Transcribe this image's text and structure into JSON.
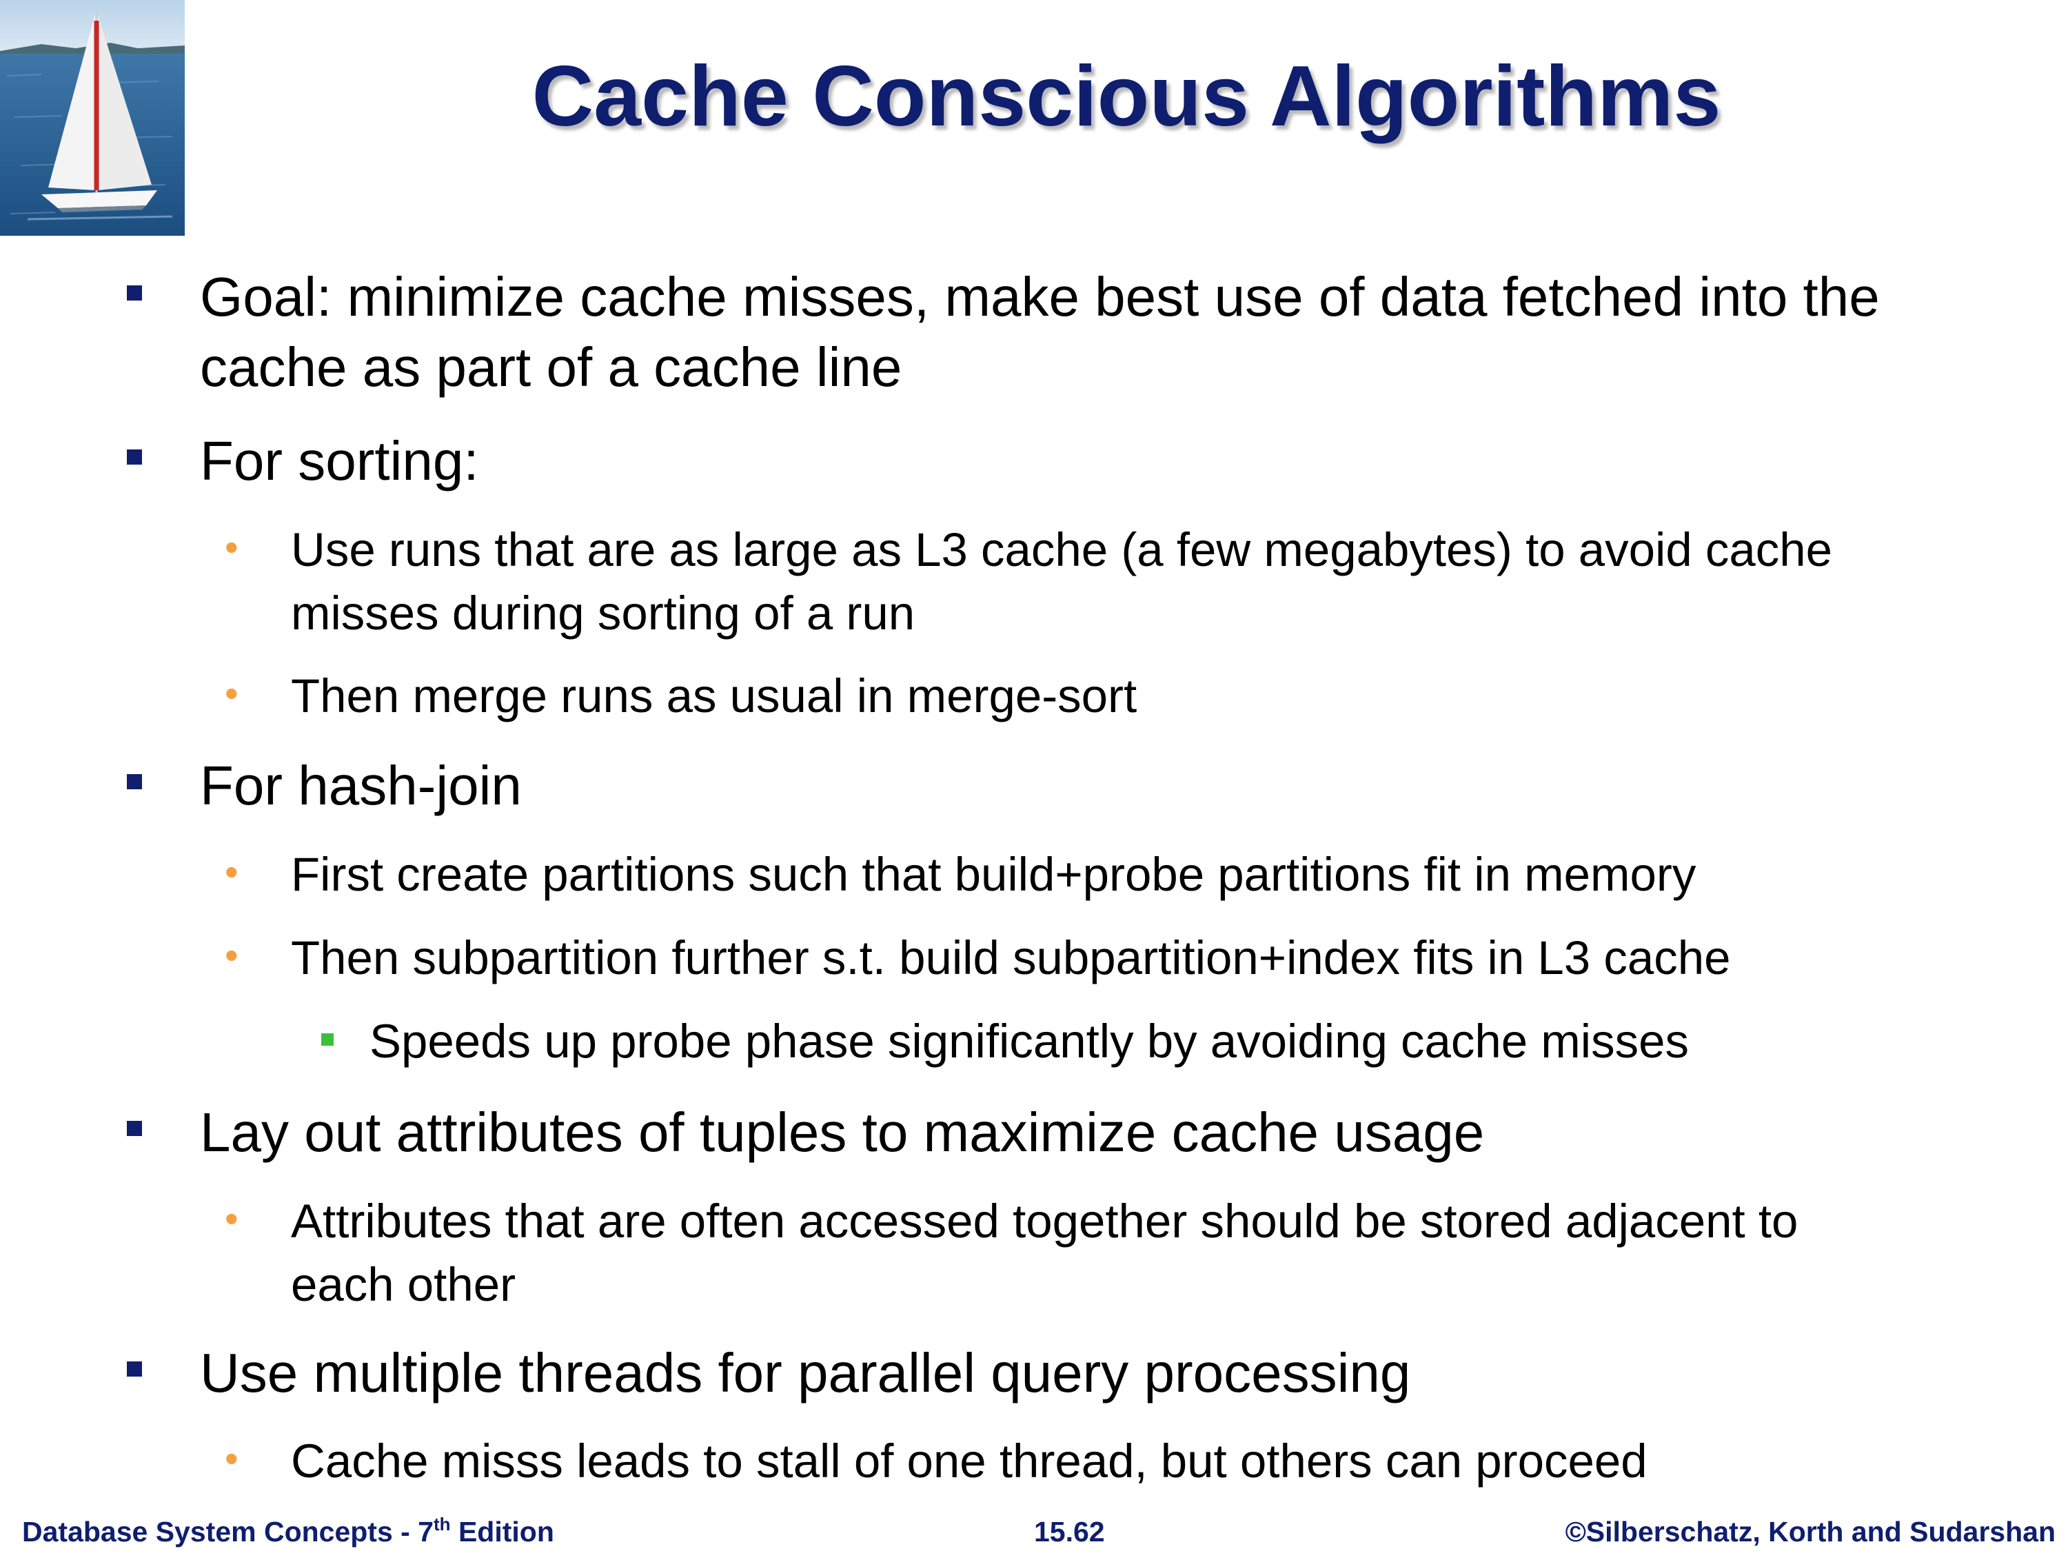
{
  "title": "Cache Conscious Algorithms",
  "bullets": [
    {
      "level": 1,
      "line1": "Goal: minimize cache misses, make best use of data fetched into the",
      "line2": "cache as part of a cache line"
    },
    {
      "level": 1,
      "line1": "For sorting:"
    },
    {
      "level": 2,
      "line1": "Use runs that are as large as L3 cache (a few megabytes) to avoid cache",
      "line2": "misses during sorting of a run"
    },
    {
      "level": 2,
      "line1": "Then merge runs as usual in merge-sort"
    },
    {
      "level": 1,
      "line1": "For hash-join"
    },
    {
      "level": 2,
      "line1": "First create partitions such that build+probe partitions fit in memory"
    },
    {
      "level": 2,
      "line1": "Then subpartition further s.t. build subpartition+index fits in L3 cache"
    },
    {
      "level": 3,
      "line1": "Speeds up probe phase significantly by avoiding cache misses"
    },
    {
      "level": 1,
      "line1": "Lay out attributes of tuples to maximize cache usage"
    },
    {
      "level": 2,
      "line1": "Attributes that are often accessed together should be stored adjacent to",
      "line2": "each other"
    },
    {
      "level": 1,
      "line1": "Use multiple threads for parallel query processing"
    },
    {
      "level": 2,
      "line1": "Cache misss leads to stall of one thread, but others can proceed"
    }
  ],
  "footer": {
    "book_prefix": "Database System Concepts - 7",
    "book_sup": "th",
    "book_suffix": " Edition",
    "page": "15.62",
    "copyright": "©Silberschatz, Korth and Sudarshan"
  },
  "colors": {
    "title": "#0f1e6e",
    "level1_bullet": "#0f1e6e",
    "level2_bullet": "#f5a040",
    "level3_bullet": "#3cc03c"
  },
  "icons": {
    "logo": "sailboat-photo-icon"
  }
}
